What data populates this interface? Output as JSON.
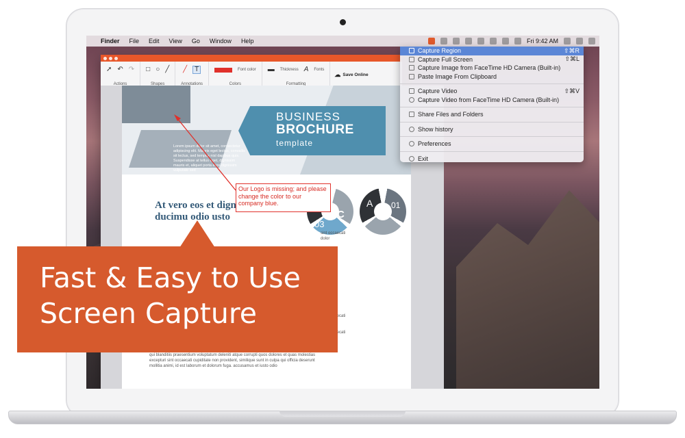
{
  "menubar": {
    "app_name": "Finder",
    "menus": [
      "File",
      "Edit",
      "View",
      "Go",
      "Window",
      "Help"
    ],
    "clock": "Fri 9:42 AM"
  },
  "toolbar": {
    "groups": [
      {
        "label": "Actions"
      },
      {
        "label": "Shapes"
      },
      {
        "label": "Annotations"
      },
      {
        "label": "Colors",
        "sublabel": "Font color"
      },
      {
        "label": "Formatting",
        "thickness": "Thickness",
        "fonts": "Fonts"
      }
    ],
    "save_label": "Save Online",
    "accent_color": "#e0312b"
  },
  "document": {
    "banner_line1": "BUSINESS",
    "banner_line2": "BROCHURE",
    "banner_line3": "template",
    "header_text": "Lorem ipsum dolor sit amet, consectetur adipiscing elit. Mauris eget lectus, convallis sit lectus, sed tempus nisl dapibus quis. Suspendisse at tellus eget, dignissim mauris et, aliquet porta eros dignissim vulputate sed",
    "heading": "At vero eos et dignissimos ducimu odio usto",
    "body_right_1": "sint occaecati",
    "body_right_2": "dolor",
    "body_right_3": "sint occaecati",
    "body_right_4": "dolor",
    "body_right_5": "sint occaecati",
    "body_bottom": "qui blanditiis praesentium voluptatum deleniti atque corrupti quos dolores et quas molestias excepturi sint occaecati cupiditate non provident, similique sunt in culpa qui officia deserunt mollitia animi, id est laborum et dolorum fuga. accusamus et iusto odio",
    "circle_labels": [
      "C",
      "03",
      "A",
      "01"
    ],
    "brand_blue": "#4f8fae"
  },
  "annotation": {
    "text": "Our Logo is missing; and please change the color to our company blue.",
    "color": "#d72a22"
  },
  "dropdown": {
    "items": [
      {
        "label": "Capture Region",
        "shortcut": "⇧⌘R",
        "selected": true,
        "icon": "region-icon"
      },
      {
        "label": "Capture Full Screen",
        "shortcut": "⇧⌘L",
        "selected": false,
        "icon": "fullscreen-icon"
      },
      {
        "label": "Capture Image from FaceTime HD Camera (Built-in)",
        "shortcut": "",
        "selected": false,
        "icon": "camera-icon"
      },
      {
        "label": "Paste Image From Clipboard",
        "shortcut": "",
        "selected": false,
        "icon": "clipboard-icon"
      },
      {
        "label": "Capture Video",
        "shortcut": "⇧⌘V",
        "selected": false,
        "icon": "video-icon"
      },
      {
        "label": "Capture Video from FaceTime HD Camera (Built-in)",
        "shortcut": "",
        "selected": false,
        "icon": "webcam-icon"
      },
      {
        "label": "Share Files and Folders",
        "shortcut": "",
        "selected": false,
        "icon": "share-icon"
      },
      {
        "label": "Show history",
        "shortcut": "",
        "selected": false,
        "icon": "history-icon"
      },
      {
        "label": "Preferences",
        "shortcut": "",
        "selected": false,
        "icon": "gear-icon"
      },
      {
        "label": "Exit",
        "shortcut": "",
        "selected": false,
        "icon": "power-icon"
      }
    ],
    "highlight_color": "#5b86d6"
  },
  "callout": {
    "line1": "Fast & Easy to Use",
    "line2": "Screen Capture",
    "color": "#d65a2d"
  }
}
